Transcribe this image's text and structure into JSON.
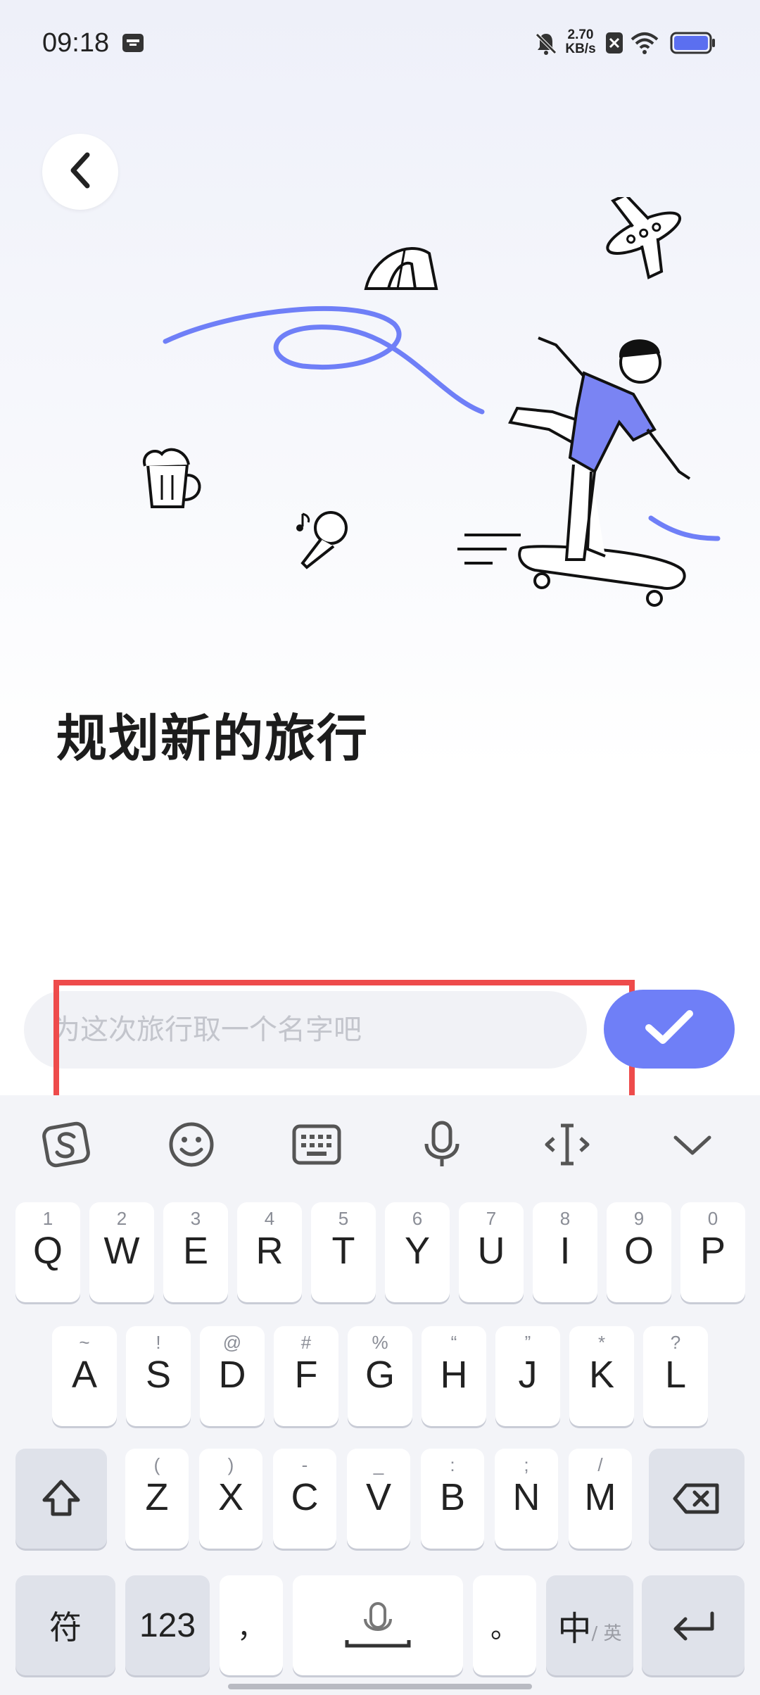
{
  "status_bar": {
    "time": "09:18",
    "speed_value": "2.70",
    "speed_unit": "KB/s"
  },
  "header": {
    "back_icon": "chevron-left-icon"
  },
  "main": {
    "title": "规划新的旅行",
    "name_input": {
      "value": "",
      "placeholder": "为这次旅行取一个名字吧"
    },
    "confirm_icon": "check-icon"
  },
  "colors": {
    "accent": "#6f7ff7",
    "highlight": "#ee4b4b",
    "title_text": "#1c1c1c"
  },
  "keyboard": {
    "toolbar": [
      "sogou-logo-icon",
      "emoji-icon",
      "keyboard-icon",
      "microphone-icon",
      "cursor-icon",
      "collapse-icon"
    ],
    "row1": [
      {
        "main": "Q",
        "sub": "1"
      },
      {
        "main": "W",
        "sub": "2"
      },
      {
        "main": "E",
        "sub": "3"
      },
      {
        "main": "R",
        "sub": "4"
      },
      {
        "main": "T",
        "sub": "5"
      },
      {
        "main": "Y",
        "sub": "6"
      },
      {
        "main": "U",
        "sub": "7"
      },
      {
        "main": "I",
        "sub": "8"
      },
      {
        "main": "O",
        "sub": "9"
      },
      {
        "main": "P",
        "sub": "0"
      }
    ],
    "row2": [
      {
        "main": "A",
        "sub": "~"
      },
      {
        "main": "S",
        "sub": "!"
      },
      {
        "main": "D",
        "sub": "@"
      },
      {
        "main": "F",
        "sub": "#"
      },
      {
        "main": "G",
        "sub": "%"
      },
      {
        "main": "H",
        "sub": "“"
      },
      {
        "main": "J",
        "sub": "”"
      },
      {
        "main": "K",
        "sub": "*"
      },
      {
        "main": "L",
        "sub": "?"
      }
    ],
    "row3": [
      {
        "main": "Z",
        "sub": "("
      },
      {
        "main": "X",
        "sub": ")"
      },
      {
        "main": "C",
        "sub": "-"
      },
      {
        "main": "V",
        "sub": "_"
      },
      {
        "main": "B",
        "sub": ":"
      },
      {
        "main": "N",
        "sub": ";"
      },
      {
        "main": "M",
        "sub": "/"
      }
    ],
    "symbols_key": "符",
    "numbers_key": "123",
    "comma_key": "，",
    "period_key": "。",
    "lang_main": "中",
    "lang_sub": "/ 英"
  }
}
